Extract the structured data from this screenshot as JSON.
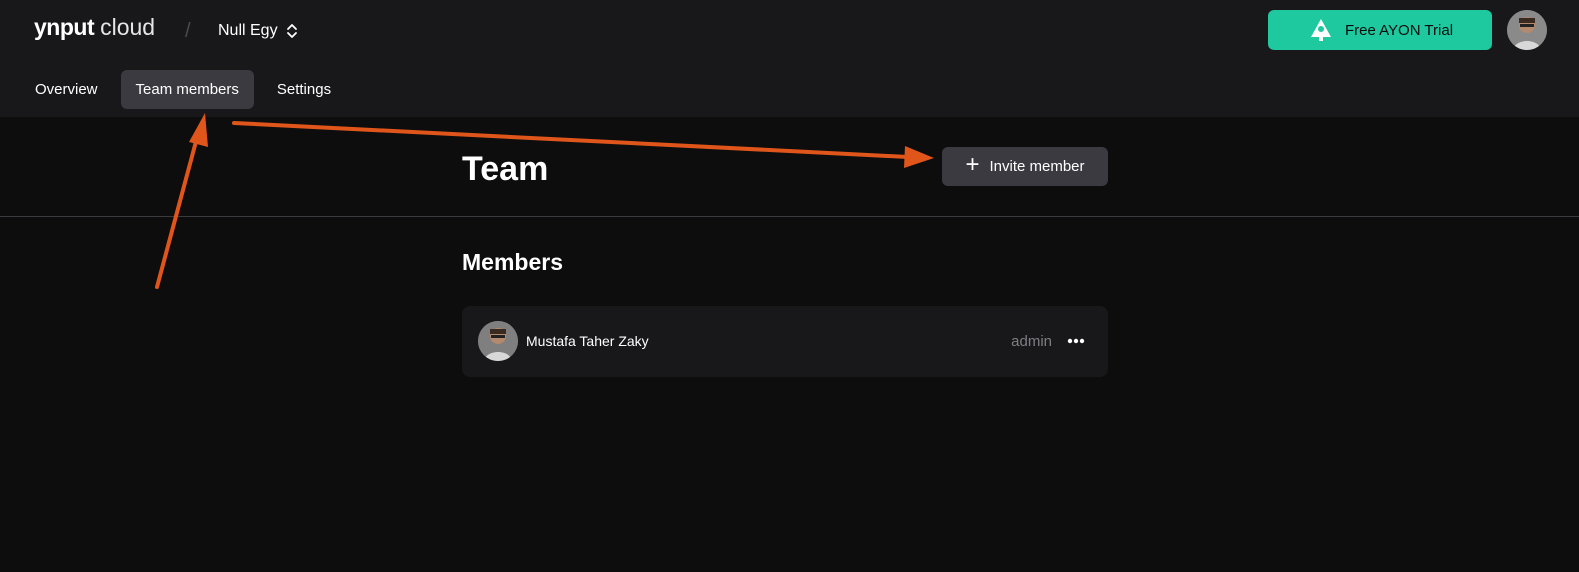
{
  "header": {
    "brand": {
      "ynput": "ynput",
      "cloud": "cloud"
    },
    "separator": "/",
    "org_name": "Null Egy",
    "trial_button_label": "Free AYON Trial"
  },
  "tabs": [
    {
      "label": "Overview",
      "active": false
    },
    {
      "label": "Team members",
      "active": true
    },
    {
      "label": "Settings",
      "active": false
    }
  ],
  "page": {
    "title": "Team",
    "invite_button_label": "Invite member",
    "members_heading": "Members"
  },
  "members": [
    {
      "name": "Mustafa Taher Zaky",
      "role": "admin"
    }
  ],
  "colors": {
    "accent": "#1ec9a0",
    "annotation_arrow": "#e0561a",
    "background": "#0d0d0e",
    "surface": "#18181b"
  },
  "icons": {
    "org_switch": "updown-chevrons-icon",
    "trial": "ayon-logo-icon",
    "invite": "plus-icon",
    "member_menu": "more-dots-icon"
  }
}
